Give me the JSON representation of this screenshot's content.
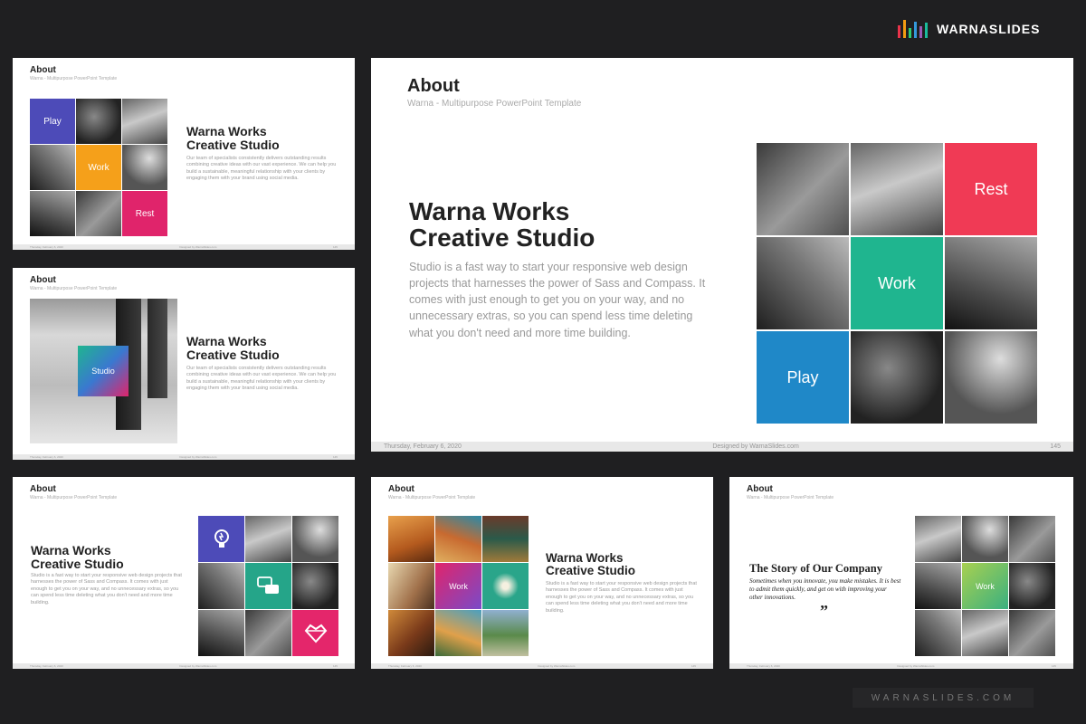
{
  "brand": {
    "name": "WARNASLIDES",
    "watermark": "WARNASLIDES.COM",
    "bar_colors": [
      "#e8334a",
      "#f39c12",
      "#2ecc71",
      "#3498db",
      "#9b59b6",
      "#1abc9c"
    ]
  },
  "common": {
    "title": "About",
    "subtitle": "Warna - Multipurpose PowerPoint Template",
    "footer_date": "Thursday, February 6, 2020",
    "footer_designed": "Designed by WarnaSlides.com",
    "page_number": "145"
  },
  "studio": {
    "heading_line1": "Warna Works",
    "heading_line2": "Creative Studio",
    "body_long": "Studio is a fast way to start your responsive web design projects that harnesses the power of Sass and Compass. It comes with just enough to get you on your way, and no unnecessary extras, so you can spend less time deleting what you don't need and more time building.",
    "body_team": "Our team of specialists consistently delivers outstanding results combining creative ideas with our vast experience. We can help you build a sustainable, meaningful relationship with your clients by engaging them with your brand using social media."
  },
  "tiles": {
    "play": "Play",
    "work": "Work",
    "rest": "Rest",
    "studio": "Studio"
  },
  "story": {
    "heading": "The Story of Our Company",
    "quote": "Sometimes when you innovate, you make mistakes. It is best to admit them quickly, and get on with improving your other innovations.",
    "quote_mark": "”"
  },
  "colors": {
    "purple": "#4d4bb8",
    "orange": "#f5a01a",
    "pink": "#e0246b",
    "red": "#f03a55",
    "teal": "#1fb58f",
    "blue": "#1f88c8",
    "green": "#25a589",
    "heart_pink": "#e4266b"
  }
}
